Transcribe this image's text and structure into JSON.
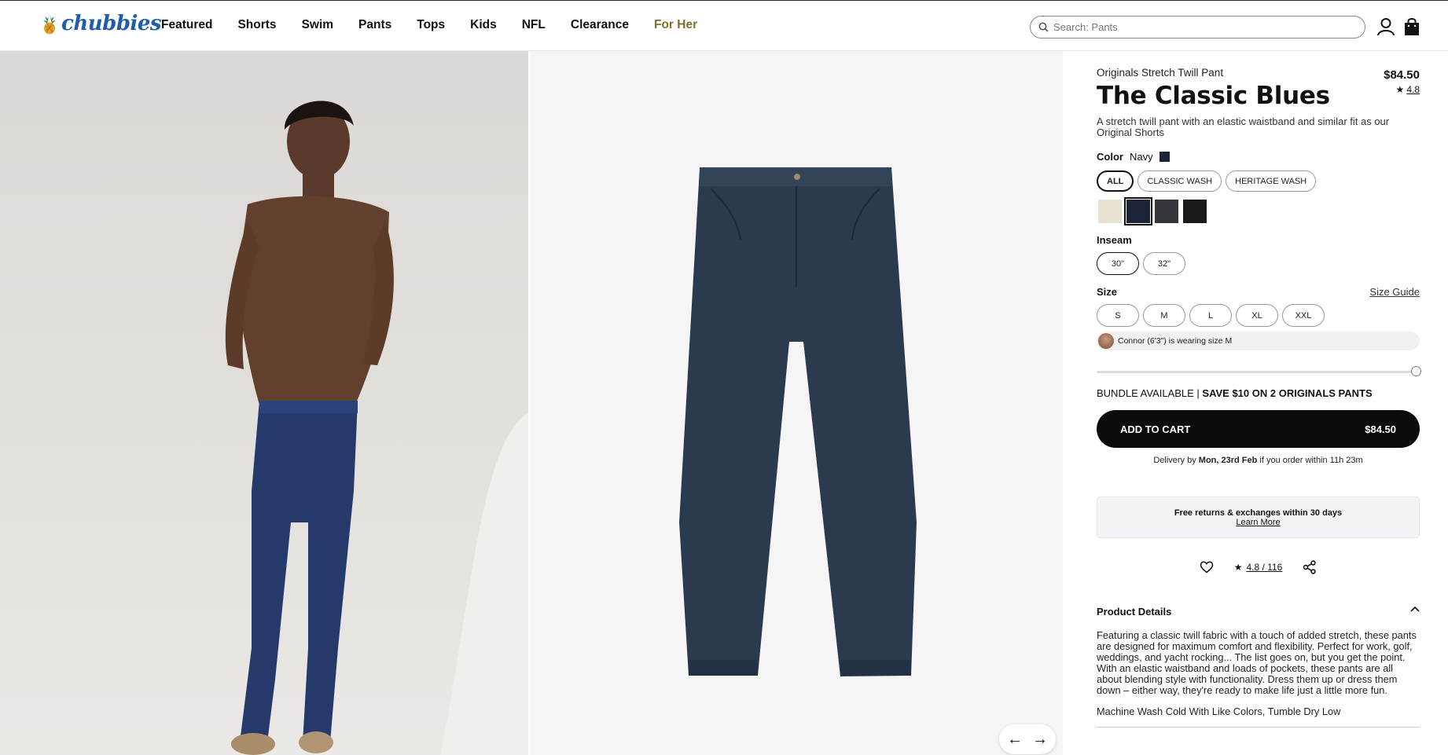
{
  "header": {
    "logo": "chubbies",
    "nav": [
      "Featured",
      "Shorts",
      "Swim",
      "Pants",
      "Tops",
      "Kids",
      "NFL",
      "Clearance",
      "For Her"
    ],
    "search_placeholder": "Search: Pants",
    "icons": [
      "search-icon",
      "account-icon",
      "cart-bag-icon"
    ]
  },
  "gallery": {
    "prev": "←",
    "next": "→"
  },
  "product": {
    "subtitle": "Originals Stretch Twill Pant",
    "price": "$84.50",
    "title": "The Classic Blues",
    "rating": "4.8",
    "description": "A stretch twill pant with an elastic waistband and similar fit as our Original Shorts",
    "color_label": "Color",
    "color_value": "Navy",
    "wash_filters": [
      "ALL",
      "CLASSIC WASH",
      "HERITAGE WASH"
    ],
    "swatches": [
      {
        "name": "Cream",
        "hex": "#e6e1d0"
      },
      {
        "name": "Navy",
        "hex": "#1c2538"
      },
      {
        "name": "Charcoal",
        "hex": "#33363b"
      },
      {
        "name": "Black",
        "hex": "#181a1c"
      }
    ],
    "inseam_label": "Inseam",
    "inseams": [
      "30\"",
      "32\""
    ],
    "size_label": "Size",
    "size_guide": "Size Guide",
    "sizes": [
      "S",
      "M",
      "L",
      "XL",
      "XXL"
    ],
    "fit_note": "Connor (6'3\") is wearing size M",
    "bundle_prefix": "BUNDLE AVAILABLE | ",
    "bundle_offer": "SAVE $10 ON 2 ORIGINALS PANTS",
    "add_to_cart": "ADD TO CART",
    "cart_price": "$84.50",
    "delivery_pre": "Delivery by ",
    "delivery_date": "Mon, 23rd Feb",
    "delivery_post": " if you order within 11h 23m",
    "returns_title": "Free returns & exchanges within 30 days",
    "returns_link": "Learn More",
    "review_summary": "4.8 / 116",
    "details_heading": "Product Details",
    "details_text": "Featuring a classic twill fabric with a touch of added stretch, these pants are designed for maximum comfort and flexibility. Perfect for work, golf, weddings, and yacht rocking... The list goes on, but you get the point. With an elastic waistband and loads of pockets, these pants are all about blending style with functionality. Dress them up or dress them down – either way, they're ready to make life just a little more fun.",
    "care": "Machine Wash Cold With Like Colors, Tumble Dry Low"
  }
}
